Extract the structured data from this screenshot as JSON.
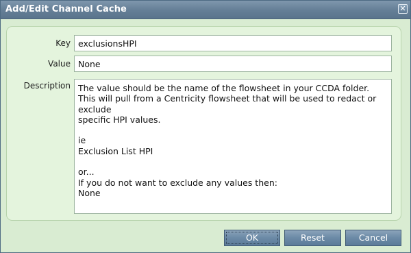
{
  "dialog": {
    "title": "Add/Edit Channel Cache",
    "close_glyph": "✕",
    "close_icon": "close-icon"
  },
  "form": {
    "key_label": "Key",
    "key_value": "exclusionsHPI",
    "value_label": "Value",
    "value_value": "None",
    "description_label": "Description",
    "description_lines": [
      "The value should be the name of the flowsheet in your CCDA folder.",
      "This will pull from a Centricity flowsheet that will be used to redact or exclude",
      "specific HPI values.",
      "",
      "ie",
      "Exclusion List HPI",
      "",
      "or...",
      "If you do not want to exclude any values then:",
      "None"
    ]
  },
  "buttons": {
    "ok": "OK",
    "reset": "Reset",
    "cancel": "Cancel"
  },
  "colors": {
    "titlebar": "#647e96",
    "dialog_bg": "#d9ecd2",
    "panel_bg": "#e4f4dd",
    "button": "#6b8aa6"
  }
}
